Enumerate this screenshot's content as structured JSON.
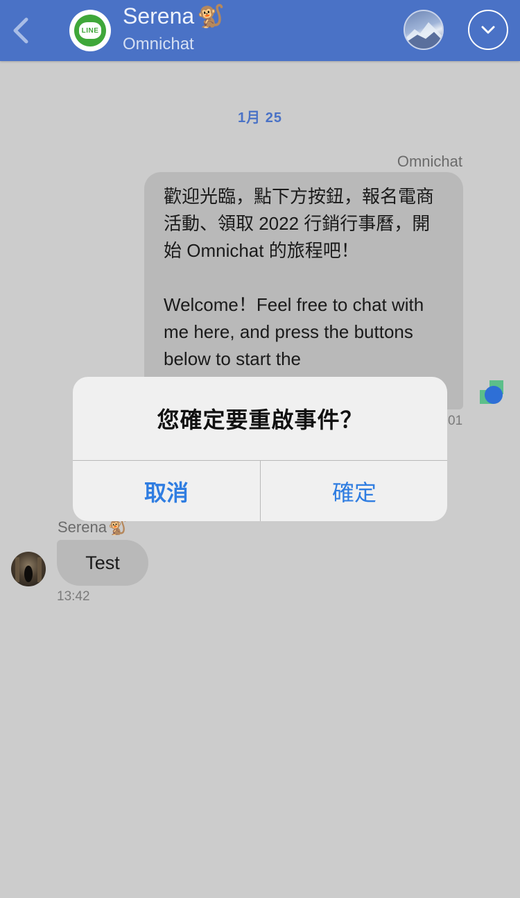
{
  "header": {
    "contact_name": "Serena",
    "contact_emoji": "🐒",
    "channel": "Omnichat",
    "line_badge_text": "LINE",
    "accent_color": "#4a72c6"
  },
  "conversation": {
    "date_separator": "1月 25",
    "outgoing": {
      "sender": "Omnichat",
      "text_zh": "歡迎光臨，點下方按鈕，報名電商活動、領取 2022 行銷行事曆，開始 Omnichat 的旅程吧！",
      "text_en": "Welcome！Feel free to chat with me here, and press the buttons below to start the",
      "time_partial": "01"
    },
    "incoming": {
      "sender": "Serena",
      "sender_emoji": "🐒",
      "text": "Test",
      "time": "13:42"
    }
  },
  "dialog": {
    "title": "您確定要重啟事件？",
    "cancel_label": "取消",
    "confirm_label": "確定",
    "button_color": "#2f7de1"
  }
}
